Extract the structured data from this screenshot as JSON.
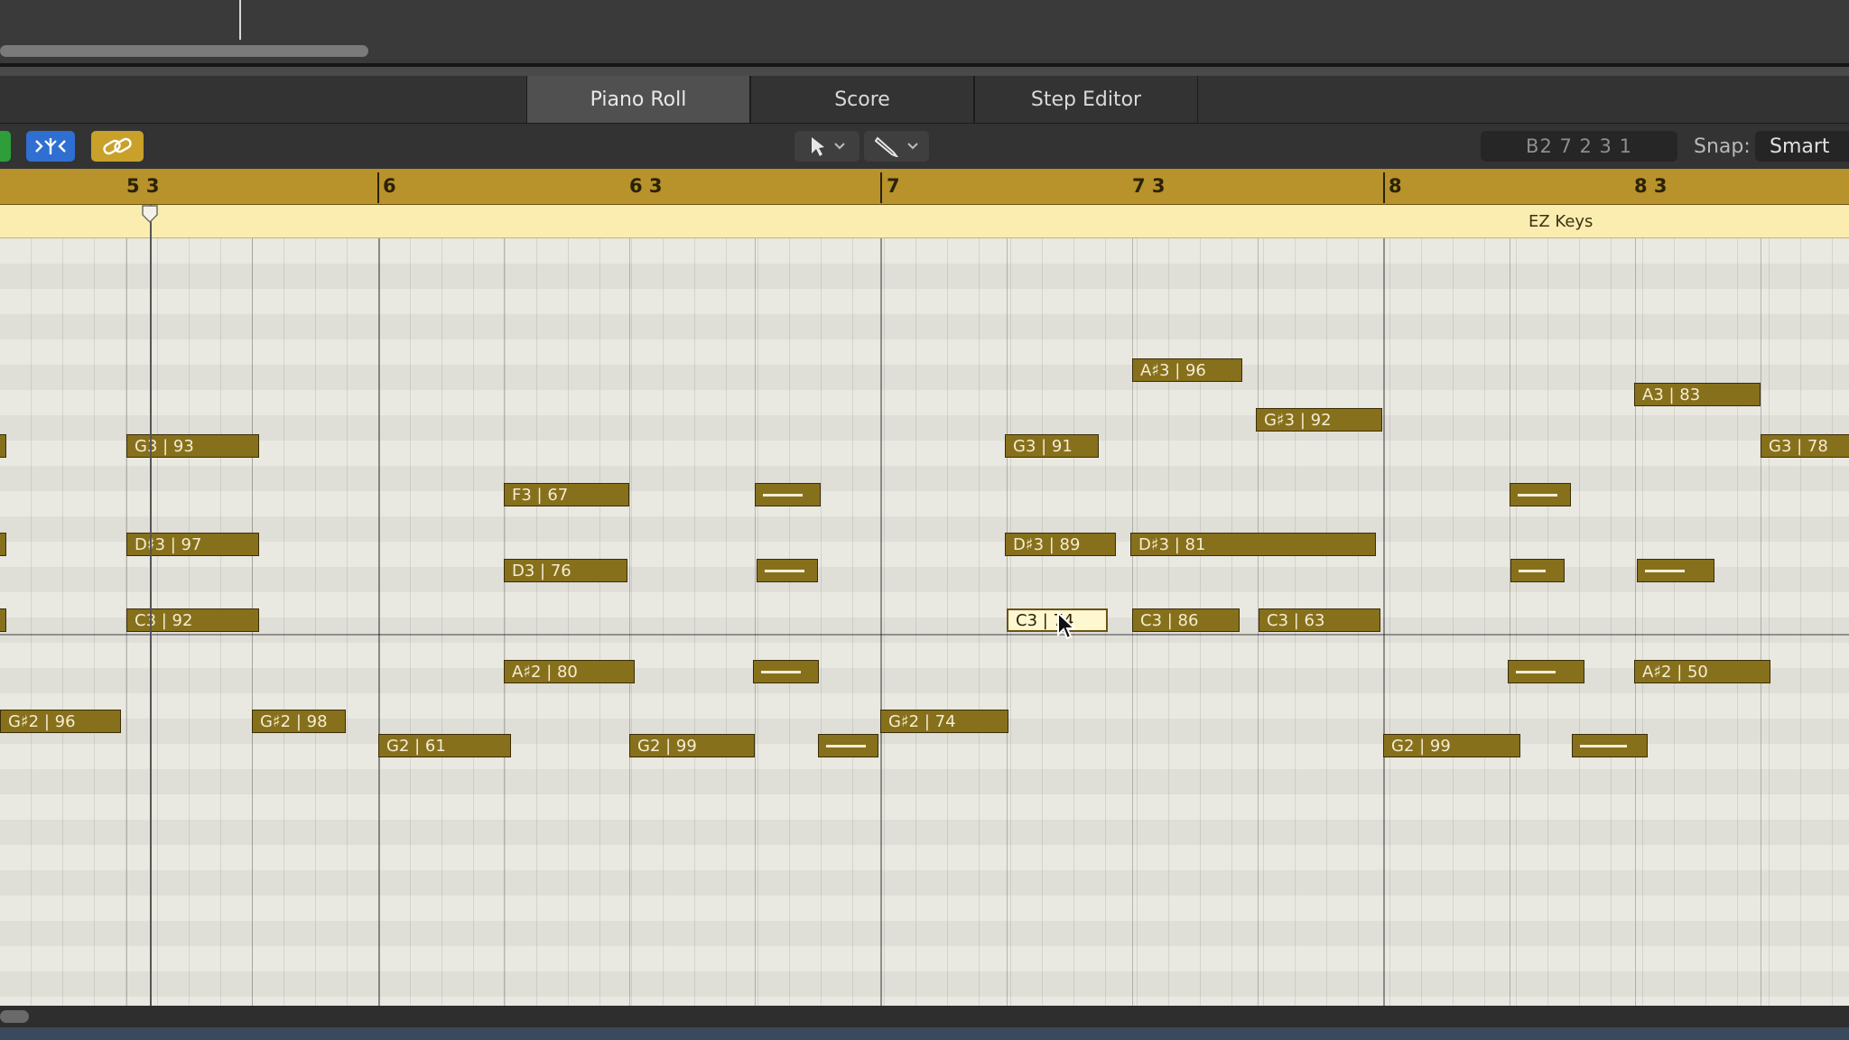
{
  "tabs": [
    {
      "label": "Piano Roll",
      "active": true
    },
    {
      "label": "Score",
      "active": false
    },
    {
      "label": "Step Editor",
      "active": false
    }
  ],
  "toolbar": {
    "lcd_display": "B2   7 2 3 1",
    "snap_label": "Snap:",
    "snap_value": "Smart",
    "pointer_tool_icon": "arrow-pointer-icon",
    "pencil_tool_icon": "pencil-icon"
  },
  "ruler": {
    "bars": [
      "5 3",
      "6",
      "6 3",
      "7",
      "7 3",
      "8",
      "8 3"
    ]
  },
  "region": {
    "name": "EZ Keys"
  },
  "notes": [
    {
      "label": "G3 | 93"
    },
    {
      "label": "D♯3 | 97"
    },
    {
      "label": "C3 | 92"
    },
    {
      "label": "G♯2 | 96"
    },
    {
      "label": "G♯2 | 98"
    },
    {
      "label": "G2 | 61"
    },
    {
      "label": "F3 | 67"
    },
    {
      "label": "D3 | 76"
    },
    {
      "label": "A♯2 | 80"
    },
    {
      "label": "G2 | 99"
    },
    {
      "label": "G♯2 | 74"
    },
    {
      "label": "G3 | 91"
    },
    {
      "label": "D♯3 | 89"
    },
    {
      "label": "C3 | 74"
    },
    {
      "label": "A♯3 | 96"
    },
    {
      "label": "D♯3 | 81"
    },
    {
      "label": "C3 | 86"
    },
    {
      "label": "G♯3 | 92"
    },
    {
      "label": "C3 | 63"
    },
    {
      "label": "G2 | 99"
    },
    {
      "label": "A3 | 83"
    },
    {
      "label": "A♯2 | 50"
    },
    {
      "label": "G3 | 78"
    }
  ]
}
